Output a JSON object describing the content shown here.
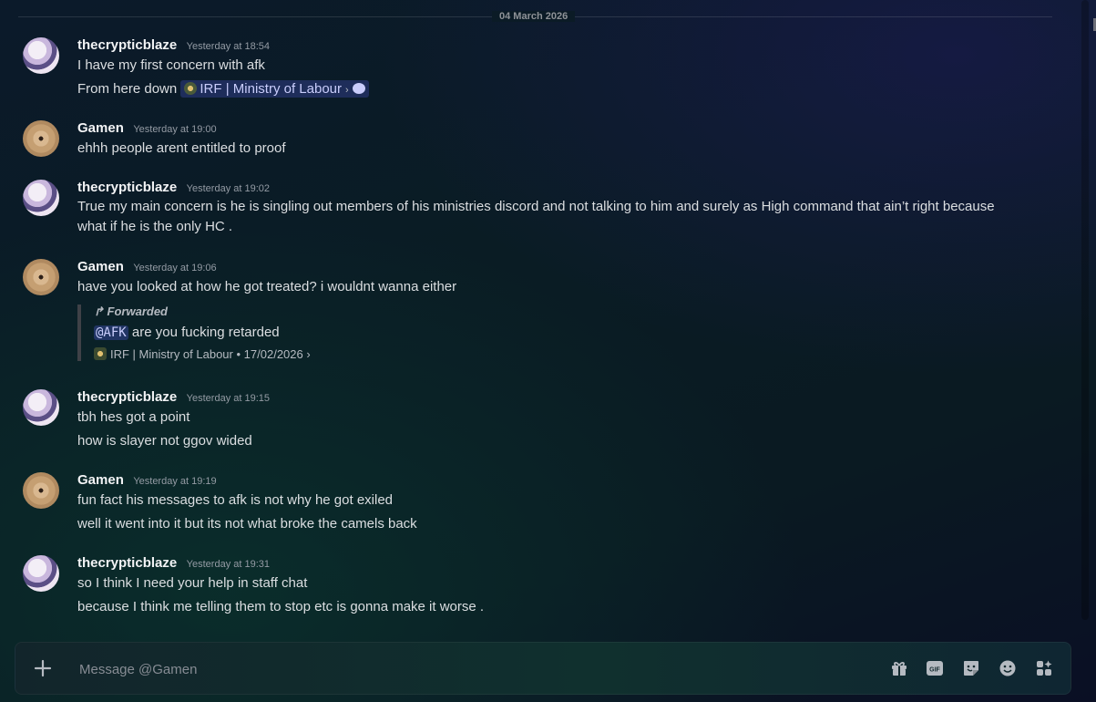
{
  "date_divider": "04 March 2026",
  "messages": [
    {
      "author": "thecrypticblaze",
      "time": "Yesterday at 18:54",
      "lines": [
        "I have my first concern with afk",
        "From here down"
      ],
      "channel_chip": "IRF | Ministry of Labour"
    },
    {
      "author": "Gamen",
      "time": "Yesterday at 19:00",
      "lines": [
        "ehhh people arent entitled to proof"
      ]
    },
    {
      "author": "thecrypticblaze",
      "time": "Yesterday at 19:02",
      "lines": [
        "True my main concern is he is singling out members of his ministries discord and not talking to him and surely as High command that ain’t right because what if he is the only HC ."
      ]
    },
    {
      "author": "Gamen",
      "time": "Yesterday at 19:06",
      "lines": [
        "have you looked at how he got treated? i wouldnt wanna either"
      ],
      "forward": {
        "label": "Forwarded",
        "mention": "@AFK",
        "text": "are you fucking retarded",
        "source": "IRF | Ministry of Labour",
        "date": "17/02/2026"
      }
    },
    {
      "author": "thecrypticblaze",
      "time": "Yesterday at 19:15",
      "lines": [
        "tbh hes got a point",
        "how is slayer not ggov wided"
      ]
    },
    {
      "author": "Gamen",
      "time": "Yesterday at 19:19",
      "lines": [
        "fun fact his messages to afk is not why he got exiled",
        "well it went into it but its not what broke the camels back"
      ]
    },
    {
      "author": "thecrypticblaze",
      "time": "Yesterday at 19:31",
      "lines": [
        "so I think I need your help in staff chat",
        "because I think me telling them to stop etc is gonna make it worse ."
      ]
    }
  ],
  "composer": {
    "placeholder": "Message @Gamen",
    "tools": [
      "gift-icon",
      "gif-icon",
      "sticker-icon",
      "emoji-icon",
      "apps-icon"
    ],
    "gif_label": "GIF"
  },
  "colors": {
    "accent": "#5865f2",
    "mention_text": "#c9cdfb",
    "username": "#f2f3f5",
    "timestamp": "#949ba4"
  }
}
